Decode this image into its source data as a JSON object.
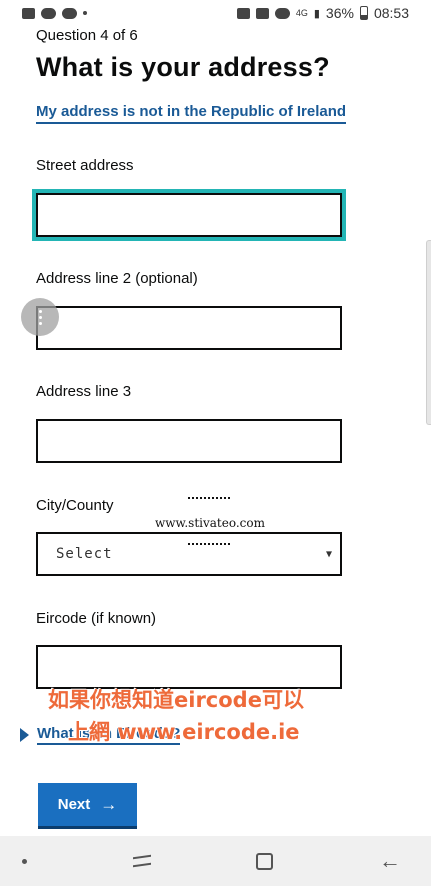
{
  "status_bar": {
    "left_icons": [
      "gallery-icon",
      "line-icon",
      "line-icon",
      "dot-icon"
    ],
    "network_label": "4G",
    "battery_percent": "36%",
    "time": "08:53"
  },
  "form": {
    "caption": "Question 4 of 6",
    "title": "What is your address?",
    "not_ireland_link": "My address is not in the Republic of Ireland",
    "street_label": "Street address",
    "street_value": "",
    "line2_label": "Address line 2 (optional)",
    "line2_value": "",
    "line3_label": "Address line 3",
    "line3_value": "",
    "city_label": "City/County",
    "city_selected": "Select",
    "eircode_label": "Eircode (if known)",
    "eircode_value": "",
    "eircode_help_link": "What is an Eircode?",
    "next_button": "Next",
    "next_arrow": "→"
  },
  "overlays": {
    "watermark": "www.stivateo.com",
    "note_line1": "如果你想知道eircode可以",
    "note_line2": "上網 www.eircode.ie"
  },
  "colors": {
    "link": "#1a5a96",
    "focus_ring": "#23b5b5",
    "button": "#1a6fc0",
    "note": "#ee6a3a"
  }
}
